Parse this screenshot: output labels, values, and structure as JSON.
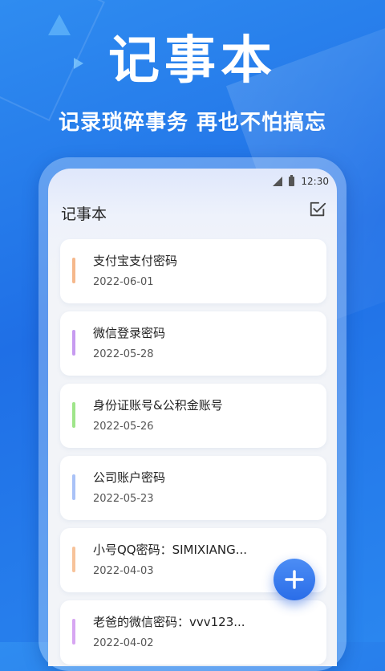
{
  "hero": {
    "title": "记事本",
    "subtitle": "记录琐碎事务  再也不怕搞忘"
  },
  "status_bar": {
    "time": "12:30"
  },
  "app": {
    "title": "记事本",
    "edit_icon": "checkbox-edit-icon"
  },
  "notes": [
    {
      "title": "支付宝支付密码",
      "date": "2022-06-01",
      "accent": "#f5b88c"
    },
    {
      "title": "微信登录密码",
      "date": "2022-05-28",
      "accent": "#c79bf0"
    },
    {
      "title": "身份证账号&公积金账号",
      "date": "2022-05-26",
      "accent": "#9fe58a"
    },
    {
      "title": "公司账户密码",
      "date": "2022-05-23",
      "accent": "#a9c2f7"
    },
    {
      "title": "小号QQ密码：SIMIXIANG...",
      "date": "2022-04-03",
      "accent": "#f7c39a"
    },
    {
      "title": "老爸的微信密码：vvv123...",
      "date": "2022-04-02",
      "accent": "#d7a6f2"
    }
  ],
  "fab": {
    "icon": "plus-icon"
  },
  "colors": {
    "primary": "#2a6de8",
    "background": "#2f8cf0"
  }
}
